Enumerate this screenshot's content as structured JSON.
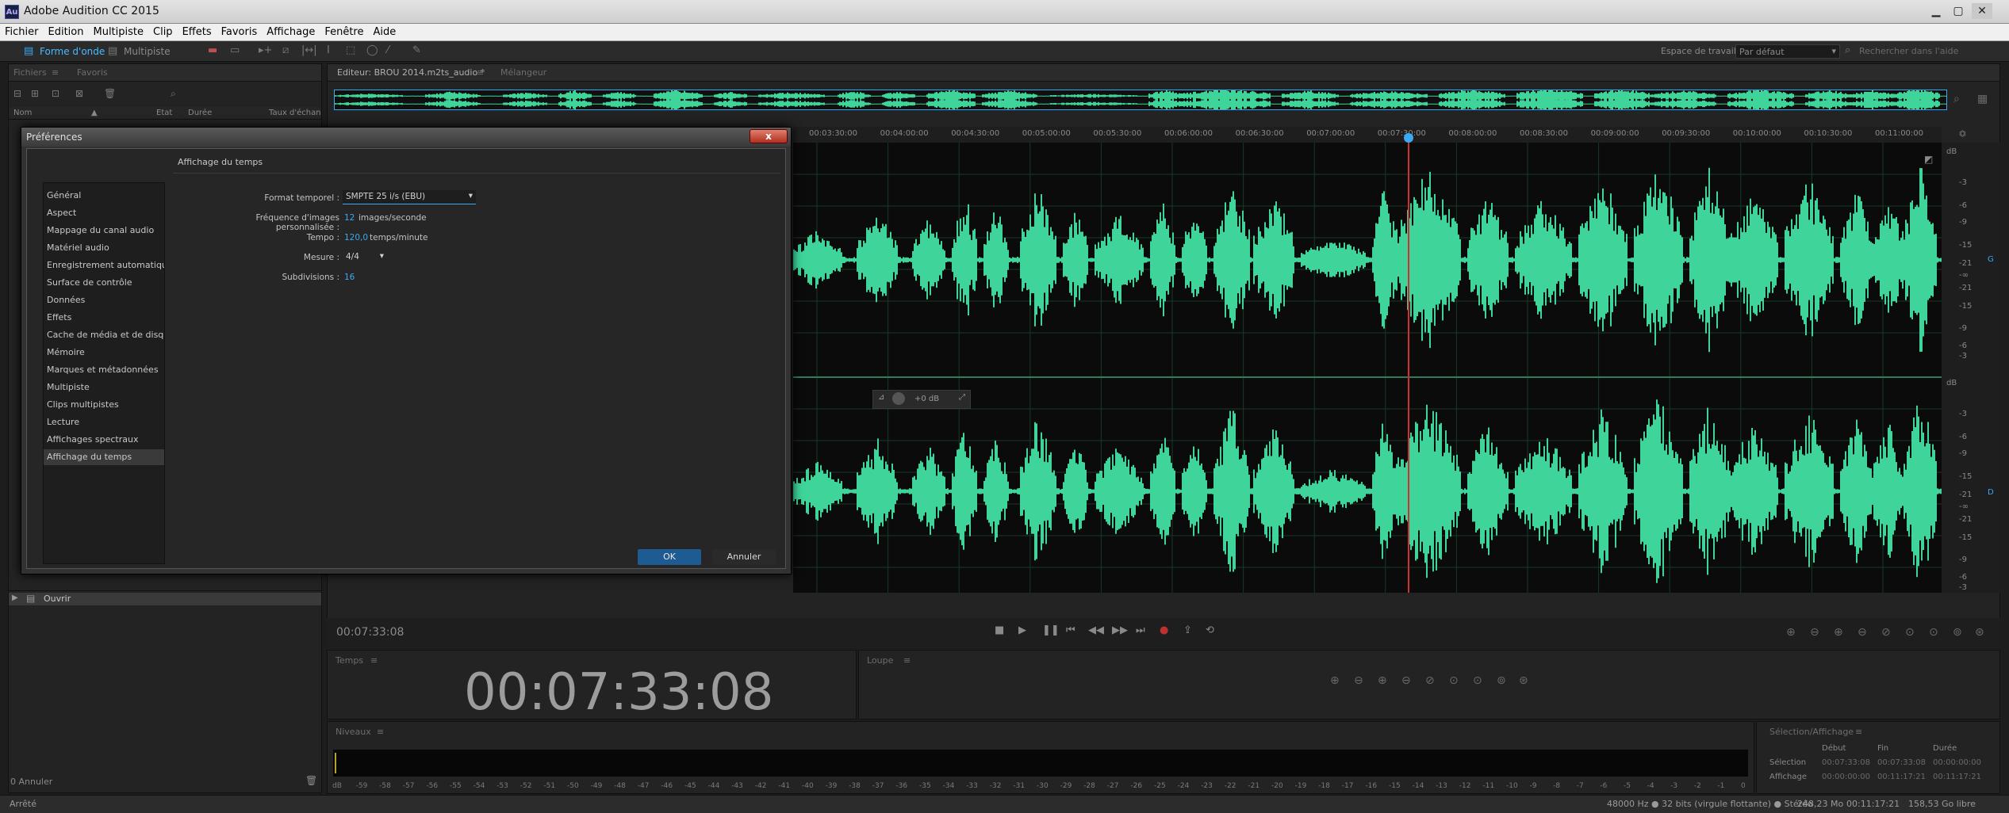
{
  "app": {
    "title": "Adobe Audition CC 2015",
    "logo": "Au"
  },
  "menu": [
    "Fichier",
    "Edition",
    "Multipiste",
    "Clip",
    "Effets",
    "Favoris",
    "Affichage",
    "Fenêtre",
    "Aide"
  ],
  "toolbar": {
    "waveform_label": "Forme d'onde",
    "multitrack_label": "Multipiste",
    "workspace_label": "Espace de travail :",
    "workspace_value": "Par défaut",
    "help_placeholder": "Rechercher dans l'aide"
  },
  "files_panel": {
    "tabs": [
      "Fichiers",
      "Favoris"
    ],
    "columns": [
      "Nom",
      "Etat",
      "Durée",
      "Taux d'échan"
    ]
  },
  "history_panel": {
    "item": "Ouvrir",
    "footer": "0 Annuler"
  },
  "editor": {
    "tab": "Editeur: BROU 2014.m2ts_audio *",
    "mixer_tab": "Mélangeur",
    "current_time": "00:07:33:08",
    "hud_gain": "+0 dB",
    "channel_labels": [
      "G",
      "D"
    ],
    "db_unit": "dB"
  },
  "ruler": {
    "ticks": [
      "00:03:30:00",
      "00:04:00:00",
      "00:04:30:00",
      "00:05:00:00",
      "00:05:30:00",
      "00:06:00:00",
      "00:06:30:00",
      "00:07:00:00",
      "00:07:30:00",
      "00:08:00:00",
      "00:08:30:00",
      "00:09:00:00",
      "00:09:30:00",
      "00:10:00:00",
      "00:10:30:00",
      "00:11:00:00"
    ]
  },
  "db_scale": [
    "-3",
    "-6",
    "-9",
    "-15",
    "-21",
    "-∞",
    "-21",
    "-15",
    "-9",
    "-6",
    "-3"
  ],
  "time_panel": {
    "title": "Temps",
    "value": "00:07:33:08"
  },
  "zoom_panel": {
    "title": "Loupe"
  },
  "levels_panel": {
    "title": "Niveaux",
    "ticks": [
      "dB",
      "-59",
      "-58",
      "-57",
      "-56",
      "-55",
      "-54",
      "-53",
      "-52",
      "-51",
      "-50",
      "-49",
      "-48",
      "-47",
      "-46",
      "-45",
      "-44",
      "-43",
      "-42",
      "-41",
      "-40",
      "-39",
      "-38",
      "-37",
      "-36",
      "-35",
      "-34",
      "-33",
      "-32",
      "-31",
      "-30",
      "-29",
      "-28",
      "-27",
      "-26",
      "-25",
      "-24",
      "-23",
      "-22",
      "-21",
      "-20",
      "-19",
      "-18",
      "-17",
      "-16",
      "-15",
      "-14",
      "-13",
      "-12",
      "-11",
      "-10",
      "-9",
      "-8",
      "-7",
      "-6",
      "-5",
      "-4",
      "-3",
      "-2",
      "-1",
      "0"
    ]
  },
  "selection_panel": {
    "title": "Sélection/Affichage",
    "headers": [
      "Début",
      "Fin",
      "Durée"
    ],
    "rows": [
      {
        "label": "Sélection",
        "start": "00:07:33:08",
        "end": "00:07:33:08",
        "dur": "00:00:00:00"
      },
      {
        "label": "Affichage",
        "start": "00:00:00:00",
        "end": "00:11:17:21",
        "dur": "00:11:17:21"
      }
    ]
  },
  "status": {
    "left": "Arrêté",
    "format": "48000 Hz ● 32 bits (virgule flottante) ● Stéréo",
    "size": "248,23 Mo",
    "duration": "00:11:17:21",
    "free": "158,53 Go libre"
  },
  "dialog": {
    "title": "Préférences",
    "categories": [
      "Général",
      "Aspect",
      "Mappage du canal audio",
      "Matériel audio",
      "Enregistrement automatique",
      "Surface de contrôle",
      "Données",
      "Effets",
      "Cache de média et de disque",
      "Mémoire",
      "Marques et métadonnées",
      "Multipiste",
      "Clips multipistes",
      "Lecture",
      "Affichages spectraux",
      "Affichage du temps"
    ],
    "selected_index": 15,
    "section_title": "Affichage du temps",
    "fields": {
      "format_label": "Format temporel :",
      "format_value": "SMPTE 25 i/s (EBU)",
      "fps_label": "Fréquence d'images personnalisée :",
      "fps_value": "12",
      "fps_unit": "images/seconde",
      "tempo_label": "Tempo :",
      "tempo_value": "120,0",
      "tempo_unit": "temps/minute",
      "measure_label": "Mesure :",
      "measure_value": "4/4",
      "subdiv_label": "Subdivisions :",
      "subdiv_value": "16"
    },
    "ok_label": "OK",
    "cancel_label": "Annuler",
    "close_label": "x"
  },
  "colors": {
    "accent": "#3aa9f0",
    "waveform": "#3ed49a",
    "playhead": "#d03030",
    "ok_button": "#1f5b93"
  }
}
